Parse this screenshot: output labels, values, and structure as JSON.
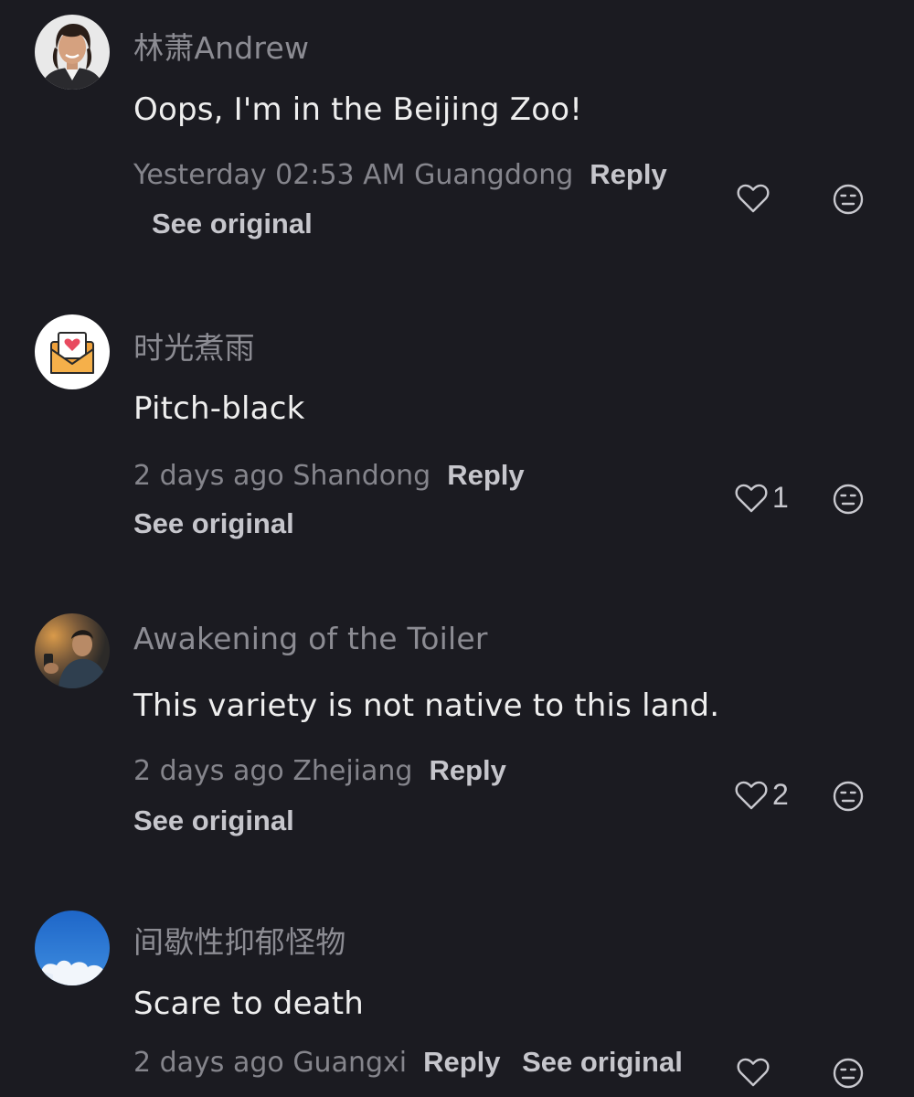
{
  "comments": [
    {
      "username": "林萧Andrew",
      "text": "Oops, I'm in the Beijing Zoo!",
      "time": "Yesterday 02:53 AM",
      "location": "Guangdong",
      "reply_label": "Reply",
      "see_original_label": "See original",
      "likes": "",
      "avatar": "man-portrait-avatar"
    },
    {
      "username": "时光煮雨",
      "text": "Pitch-black",
      "time": "2 days ago",
      "location": "Shandong",
      "reply_label": "Reply",
      "see_original_label": "See original",
      "likes": "1",
      "avatar": "heart-envelope-avatar"
    },
    {
      "username": "Awakening of the Toiler",
      "text": "This variety is not native to this land.",
      "time": "2 days ago",
      "location": "Zhejiang",
      "reply_label": "Reply",
      "see_original_label": "See original",
      "likes": "2",
      "avatar": "movie-still-avatar"
    },
    {
      "username": "间歇性抑郁怪物",
      "text": "Scare to death",
      "time": "2 days ago",
      "location": "Guangxi",
      "reply_label": "Reply",
      "see_original_label": "See original",
      "likes": "",
      "avatar": "blue-sky-avatar"
    }
  ],
  "colors": {
    "background": "#1b1b21",
    "username": "#8c8c93",
    "text": "#eeeeee",
    "meta": "#85858c",
    "action": "#c6c6cc"
  },
  "icons": {
    "like": "heart-outline-icon",
    "reaction": "neutral-face-icon"
  }
}
